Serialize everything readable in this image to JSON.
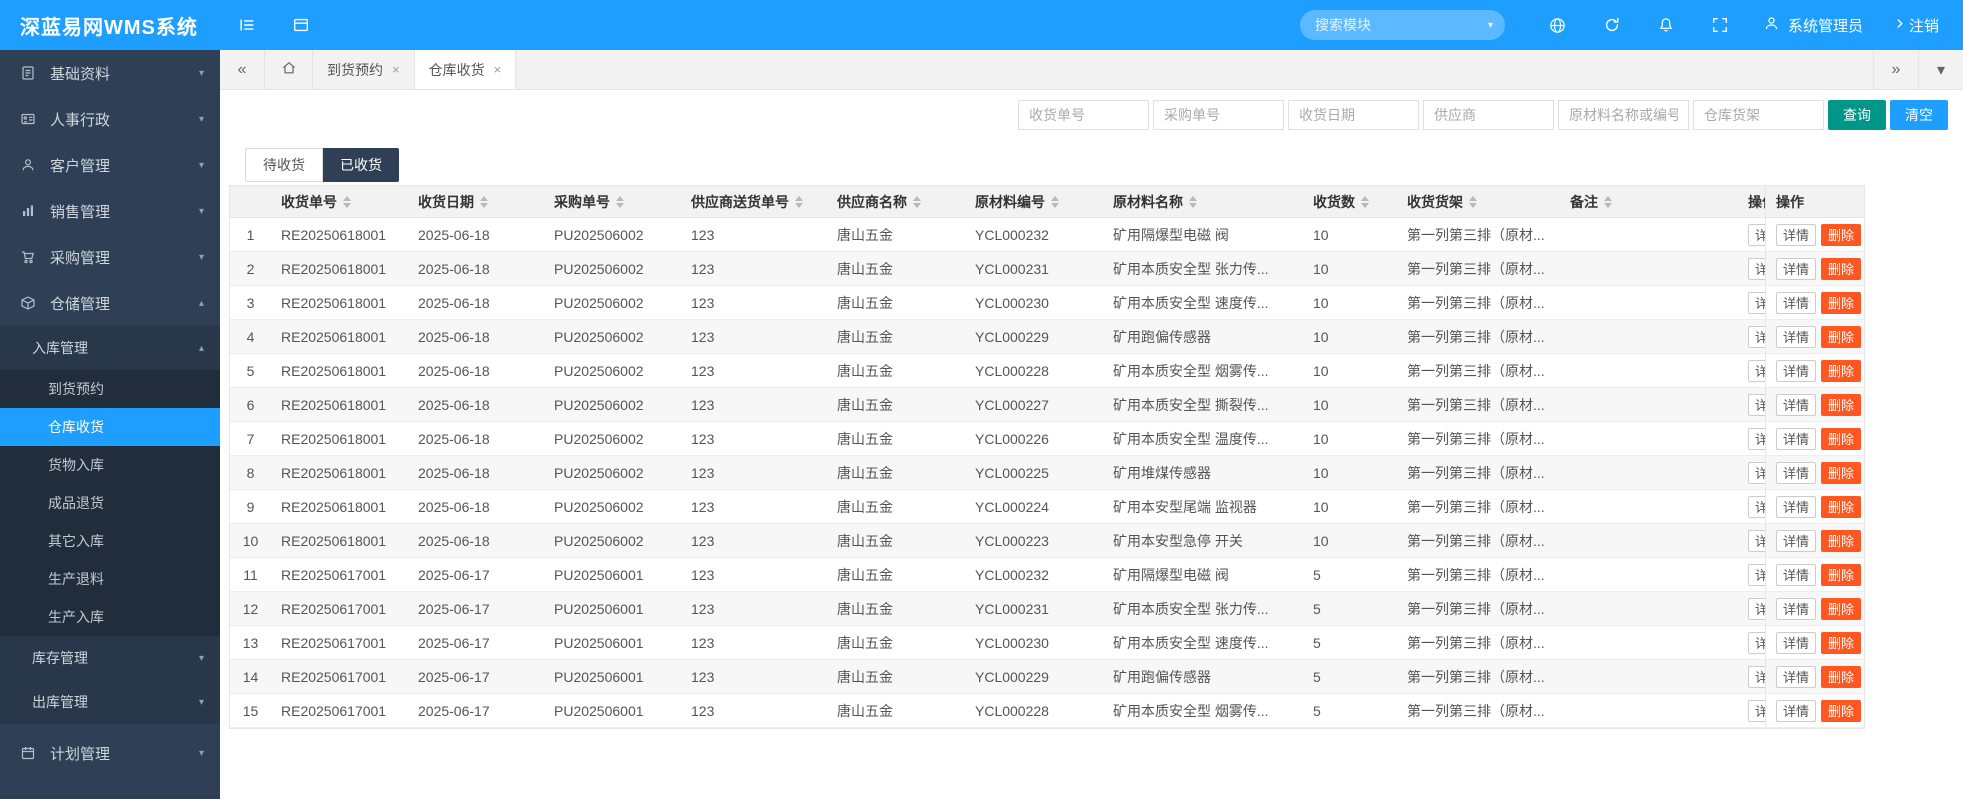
{
  "colors": {
    "primary": "#1E9FFF",
    "sidebar_bg": "#2F4056",
    "submenu_bg": "#28374A",
    "subsubmenu_bg": "#222D3C",
    "success": "#009688",
    "danger": "#FF5722",
    "table_header_bg": "#F2F2F2",
    "stripe_bg": "#F7F7F7"
  },
  "icons": {
    "caret": "▾",
    "caret_up": "▴",
    "back_glyph": "«",
    "forward_glyph": "»",
    "down_glyph": "▾",
    "close_glyph": "×"
  },
  "topbar": {
    "logo": "深蓝易网WMS系统",
    "search_placeholder": "搜索模块",
    "user": "系统管理员",
    "logout": "注销"
  },
  "sidebar": {
    "basics": "基础资料",
    "hr": "人事行政",
    "customer": "客户管理",
    "sales": "销售管理",
    "purchase": "采购管理",
    "warehouse": "仓储管理",
    "inbound": "入库管理",
    "inbound_items": [
      "到货预约",
      "仓库收货",
      "货物入库",
      "成品退货",
      "其它入库",
      "生产退料",
      "生产入库"
    ],
    "inventory": "库存管理",
    "outbound": "出库管理",
    "plan": "计划管理"
  },
  "tabbar": {
    "tabs": [
      {
        "label": "到货预约"
      },
      {
        "label": "仓库收货"
      }
    ]
  },
  "filters": {
    "placeholders": [
      "收货单号",
      "采购单号",
      "收货日期",
      "供应商",
      "原材料名称或编号",
      "仓库货架"
    ],
    "search": "查询",
    "clear": "清空"
  },
  "status_tabs": {
    "pending": "待收货",
    "received": "已收货"
  },
  "table": {
    "headers": [
      "收货单号",
      "收货日期",
      "采购单号",
      "供应商送货单号",
      "供应商名称",
      "原材料编号",
      "原材料名称",
      "收货数",
      "收货货架",
      "备注",
      "操作"
    ],
    "action_detail": "详情",
    "action_delete": "删除",
    "rows": [
      {
        "n": 1,
        "receipt_no": "RE20250618001",
        "date": "2025-06-18",
        "po_no": "PU202506002",
        "delivery_no": "123",
        "supplier": "唐山五金",
        "material_no": "YCL000232",
        "material_name": "矿用隔爆型电磁 阀",
        "qty": 10,
        "shelf": "第一列第三排（原材...",
        "remark": ""
      },
      {
        "n": 2,
        "receipt_no": "RE20250618001",
        "date": "2025-06-18",
        "po_no": "PU202506002",
        "delivery_no": "123",
        "supplier": "唐山五金",
        "material_no": "YCL000231",
        "material_name": "矿用本质安全型 张力传...",
        "qty": 10,
        "shelf": "第一列第三排（原材...",
        "remark": ""
      },
      {
        "n": 3,
        "receipt_no": "RE20250618001",
        "date": "2025-06-18",
        "po_no": "PU202506002",
        "delivery_no": "123",
        "supplier": "唐山五金",
        "material_no": "YCL000230",
        "material_name": "矿用本质安全型 速度传...",
        "qty": 10,
        "shelf": "第一列第三排（原材...",
        "remark": ""
      },
      {
        "n": 4,
        "receipt_no": "RE20250618001",
        "date": "2025-06-18",
        "po_no": "PU202506002",
        "delivery_no": "123",
        "supplier": "唐山五金",
        "material_no": "YCL000229",
        "material_name": "矿用跑偏传感器",
        "qty": 10,
        "shelf": "第一列第三排（原材...",
        "remark": ""
      },
      {
        "n": 5,
        "receipt_no": "RE20250618001",
        "date": "2025-06-18",
        "po_no": "PU202506002",
        "delivery_no": "123",
        "supplier": "唐山五金",
        "material_no": "YCL000228",
        "material_name": "矿用本质安全型 烟雾传...",
        "qty": 10,
        "shelf": "第一列第三排（原材...",
        "remark": ""
      },
      {
        "n": 6,
        "receipt_no": "RE20250618001",
        "date": "2025-06-18",
        "po_no": "PU202506002",
        "delivery_no": "123",
        "supplier": "唐山五金",
        "material_no": "YCL000227",
        "material_name": "矿用本质安全型 撕裂传...",
        "qty": 10,
        "shelf": "第一列第三排（原材...",
        "remark": ""
      },
      {
        "n": 7,
        "receipt_no": "RE20250618001",
        "date": "2025-06-18",
        "po_no": "PU202506002",
        "delivery_no": "123",
        "supplier": "唐山五金",
        "material_no": "YCL000226",
        "material_name": "矿用本质安全型 温度传...",
        "qty": 10,
        "shelf": "第一列第三排（原材...",
        "remark": ""
      },
      {
        "n": 8,
        "receipt_no": "RE20250618001",
        "date": "2025-06-18",
        "po_no": "PU202506002",
        "delivery_no": "123",
        "supplier": "唐山五金",
        "material_no": "YCL000225",
        "material_name": "矿用堆煤传感器",
        "qty": 10,
        "shelf": "第一列第三排（原材...",
        "remark": ""
      },
      {
        "n": 9,
        "receipt_no": "RE20250618001",
        "date": "2025-06-18",
        "po_no": "PU202506002",
        "delivery_no": "123",
        "supplier": "唐山五金",
        "material_no": "YCL000224",
        "material_name": "矿用本安型尾端 监视器",
        "qty": 10,
        "shelf": "第一列第三排（原材...",
        "remark": ""
      },
      {
        "n": 10,
        "receipt_no": "RE20250618001",
        "date": "2025-06-18",
        "po_no": "PU202506002",
        "delivery_no": "123",
        "supplier": "唐山五金",
        "material_no": "YCL000223",
        "material_name": "矿用本安型急停 开关",
        "qty": 10,
        "shelf": "第一列第三排（原材...",
        "remark": ""
      },
      {
        "n": 11,
        "receipt_no": "RE20250617001",
        "date": "2025-06-17",
        "po_no": "PU202506001",
        "delivery_no": "123",
        "supplier": "唐山五金",
        "material_no": "YCL000232",
        "material_name": "矿用隔爆型电磁 阀",
        "qty": 5,
        "shelf": "第一列第三排（原材...",
        "remark": ""
      },
      {
        "n": 12,
        "receipt_no": "RE20250617001",
        "date": "2025-06-17",
        "po_no": "PU202506001",
        "delivery_no": "123",
        "supplier": "唐山五金",
        "material_no": "YCL000231",
        "material_name": "矿用本质安全型 张力传...",
        "qty": 5,
        "shelf": "第一列第三排（原材...",
        "remark": ""
      },
      {
        "n": 13,
        "receipt_no": "RE20250617001",
        "date": "2025-06-17",
        "po_no": "PU202506001",
        "delivery_no": "123",
        "supplier": "唐山五金",
        "material_no": "YCL000230",
        "material_name": "矿用本质安全型 速度传...",
        "qty": 5,
        "shelf": "第一列第三排（原材...",
        "remark": ""
      },
      {
        "n": 14,
        "receipt_no": "RE20250617001",
        "date": "2025-06-17",
        "po_no": "PU202506001",
        "delivery_no": "123",
        "supplier": "唐山五金",
        "material_no": "YCL000229",
        "material_name": "矿用跑偏传感器",
        "qty": 5,
        "shelf": "第一列第三排（原材...",
        "remark": ""
      },
      {
        "n": 15,
        "receipt_no": "RE20250617001",
        "date": "2025-06-17",
        "po_no": "PU202506001",
        "delivery_no": "123",
        "supplier": "唐山五金",
        "material_no": "YCL000228",
        "material_name": "矿用本质安全型 烟雾传...",
        "qty": 5,
        "shelf": "第一列第三排（原材...",
        "remark": ""
      }
    ]
  }
}
